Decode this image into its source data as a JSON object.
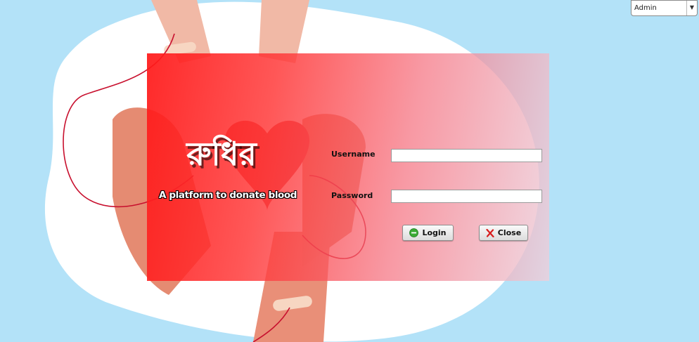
{
  "app": {
    "brand_title": "রুধির",
    "tagline": "A platform to donate blood"
  },
  "role_select": {
    "value": "Admin",
    "arrow": "▼"
  },
  "login_form": {
    "username_label": "Username",
    "username_value": "",
    "password_label": "Password",
    "password_value": "",
    "login_label": "Login",
    "close_label": "Close"
  },
  "icons": {
    "login": "green-circle-minus-icon",
    "close": "red-x-icon"
  },
  "colors": {
    "background": "#b3e2f8",
    "panel_red": "#ff1919",
    "blood_red": "#c8102e"
  }
}
